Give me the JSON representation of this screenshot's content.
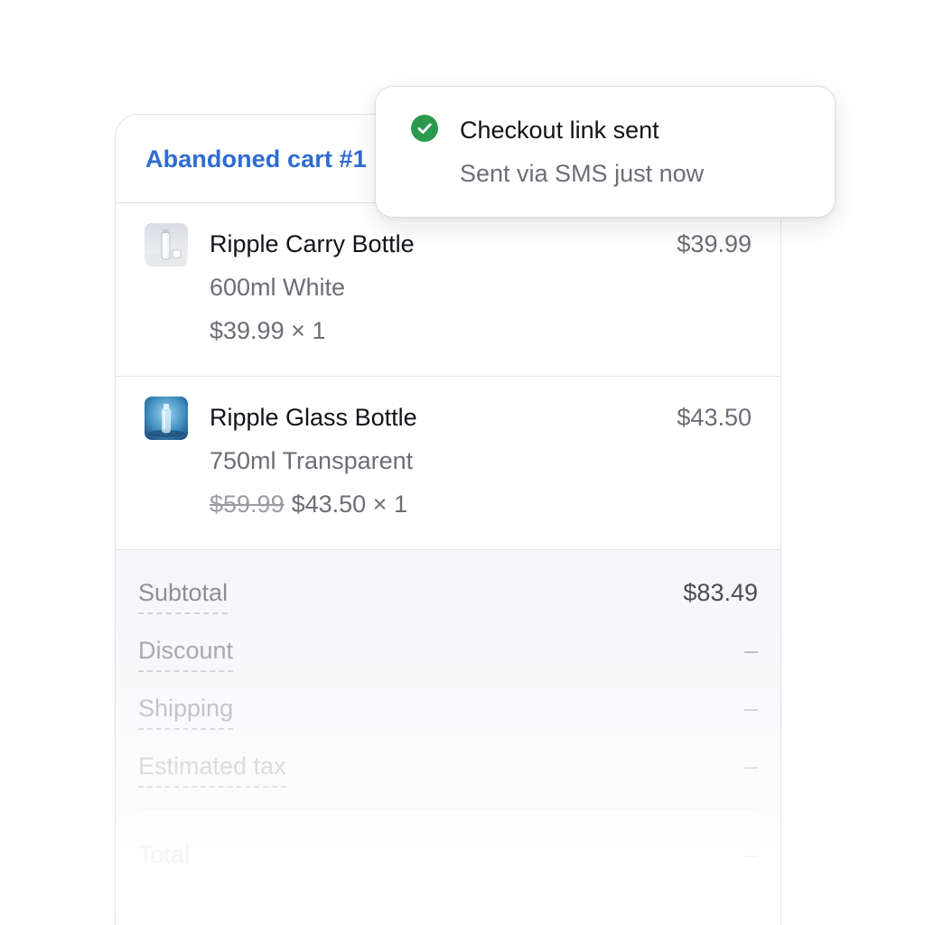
{
  "cart": {
    "title": "Abandoned cart #1",
    "items": [
      {
        "name": "Ripple Carry Bottle",
        "variant": "600ml White",
        "original_price": "",
        "unit_price": "$39.99 × 1",
        "line_total": "$39.99",
        "thumbnail": "white-bottle-image"
      },
      {
        "name": "Ripple Glass Bottle",
        "variant": "750ml Transparent",
        "original_price": "$59.99",
        "unit_price": "$43.50 × 1",
        "line_total": "$43.50",
        "thumbnail": "glass-bottle-image"
      }
    ]
  },
  "summary": {
    "subtotal_label": "Subtotal",
    "subtotal_value": "$83.49",
    "discount_label": "Discount",
    "discount_value": "–",
    "shipping_label": "Shipping",
    "shipping_value": "–",
    "tax_label": "Estimated tax",
    "tax_value": "–",
    "total_label": "Total",
    "total_value": "–"
  },
  "toast": {
    "title": "Checkout link sent",
    "message": "Sent via SMS just now",
    "icon": "check-circle-icon"
  },
  "colors": {
    "link_blue": "#2f6bd2",
    "success_green": "#2b9a4c",
    "text_primary": "#111318",
    "text_secondary": "#6b6e75"
  }
}
